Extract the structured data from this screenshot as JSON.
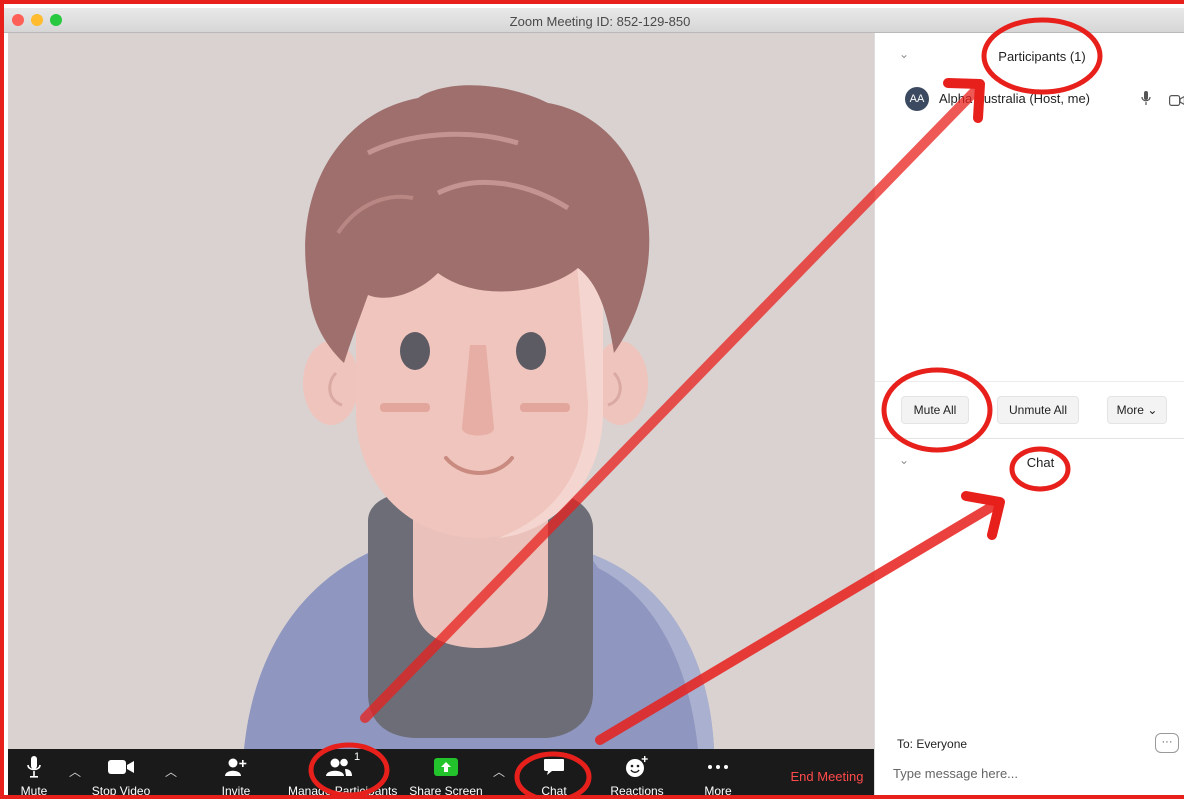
{
  "window": {
    "title": "Zoom Meeting ID: 852-129-850"
  },
  "toolbar": {
    "mute_label": "Mute",
    "stop_video_label": "Stop Video",
    "invite_label": "Invite",
    "manage_participants_label": "Manage Participants",
    "participant_count": "1",
    "share_screen_label": "Share Screen",
    "chat_label": "Chat",
    "reactions_label": "Reactions",
    "more_label": "More",
    "end_meeting_label": "End Meeting"
  },
  "participants_panel": {
    "title": "Participants (1)",
    "participants": [
      {
        "initials": "AA",
        "name": "Alpha Australia (Host, me)"
      }
    ],
    "mute_all_label": "Mute All",
    "unmute_all_label": "Unmute All",
    "more_label": "More"
  },
  "chat_panel": {
    "title": "Chat",
    "to_label": "To: Everyone",
    "input_placeholder": "Type message here..."
  },
  "colors": {
    "annotation_red": "#e8201c",
    "toolbar_bg": "#1a1a1a",
    "share_green": "#23c42b",
    "end_meeting_red": "#ff4a4a"
  }
}
